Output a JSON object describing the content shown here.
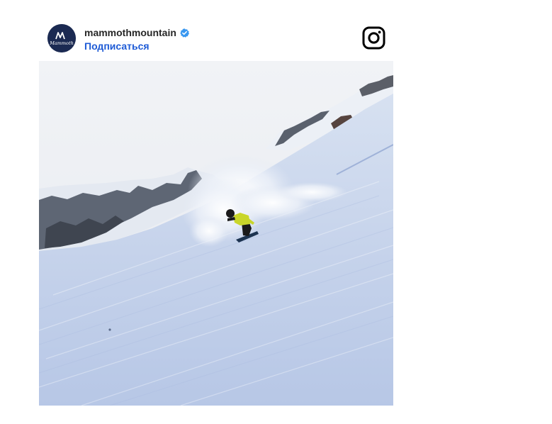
{
  "post": {
    "username": "mammothmountain",
    "follow_label": "Подписаться",
    "verified": true,
    "avatar_text": "Mammoth",
    "icons": {
      "verified": "verified-badge-icon",
      "instagram": "instagram-logo-icon"
    },
    "photo_subject": "snowboarder-carving-powder-on-mountain-slope",
    "colors": {
      "follow": "#1e5bd6",
      "verified": "#3897f0",
      "avatar_bg": "#1b2a52",
      "username": "#262626"
    }
  }
}
